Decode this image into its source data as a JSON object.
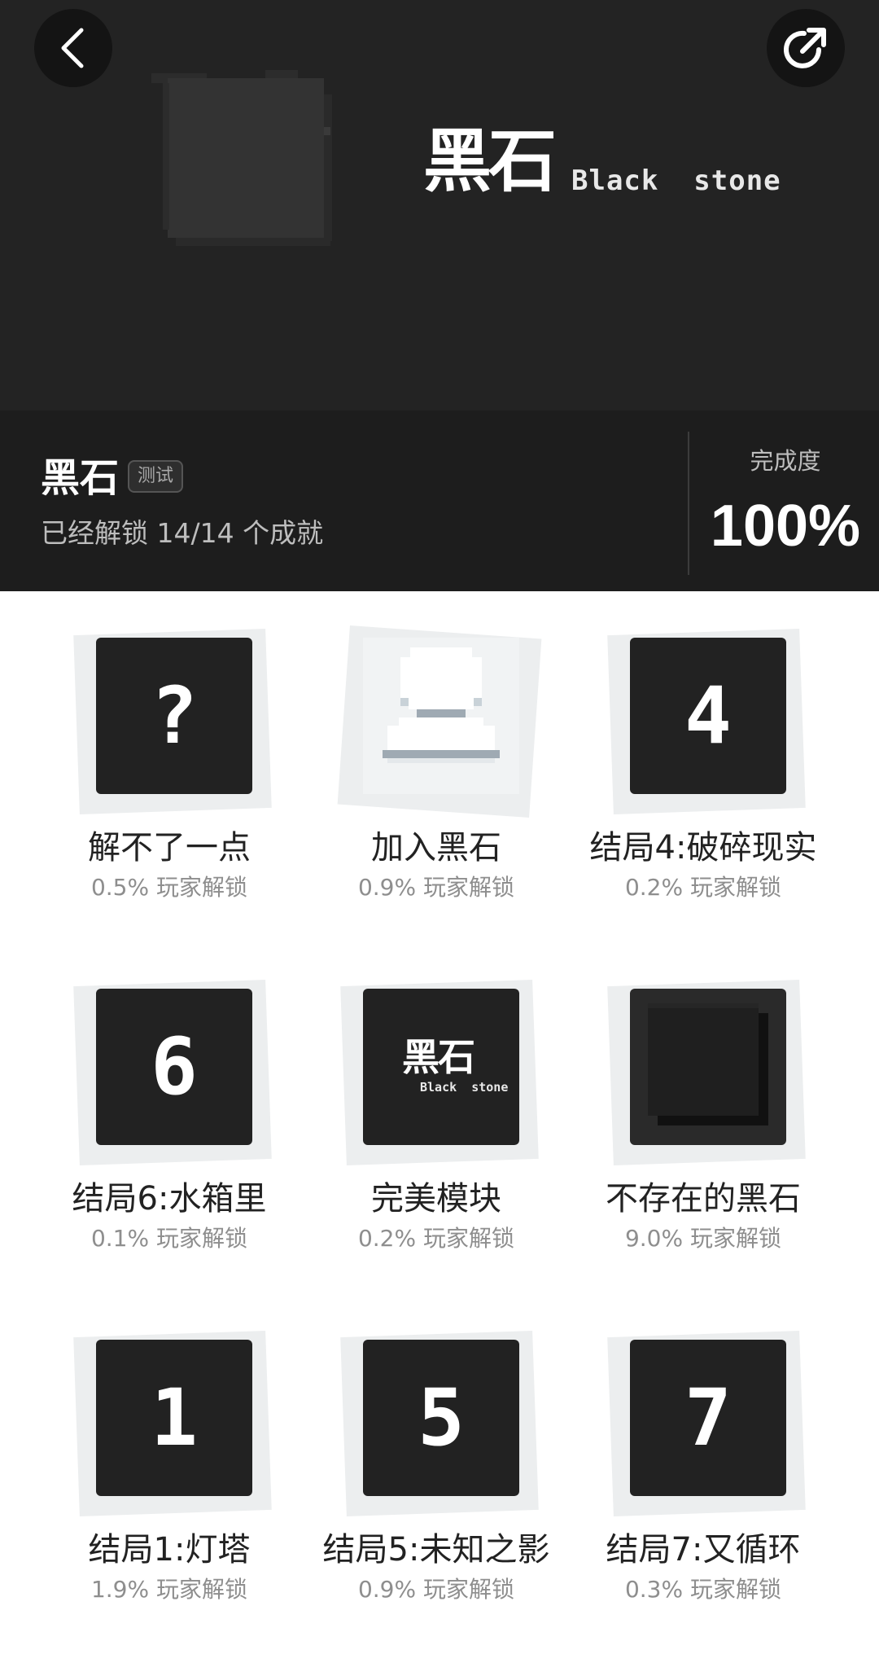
{
  "hero": {
    "logo_cn": "黑石",
    "logo_en": "Black  stone"
  },
  "game": {
    "title": "黑石",
    "tag": "测试",
    "unlock_text": "已经解锁 14/14 个成就",
    "completion_label": "完成度",
    "completion_value": "100%"
  },
  "achievements": [
    {
      "glyph": "?",
      "name": "解不了一点",
      "rate": "0.5% 玩家解锁"
    },
    {
      "glyph": "",
      "icon": "person-icon",
      "name": "加入黑石",
      "rate": "0.9% 玩家解锁"
    },
    {
      "glyph": "4",
      "name": "结局4:破碎现实",
      "rate": "0.2% 玩家解锁"
    },
    {
      "glyph": "6",
      "name": "结局6:水箱里",
      "rate": "0.1% 玩家解锁"
    },
    {
      "glyph": "",
      "icon": "black-stone-logo-icon",
      "logo_cn": "黑石",
      "logo_en": "Black  stone",
      "name": "完美模块",
      "rate": "0.2% 玩家解锁"
    },
    {
      "glyph": "",
      "icon": "black-square-icon",
      "name": "不存在的黑石",
      "rate": "9.0% 玩家解锁"
    },
    {
      "glyph": "1",
      "name": "结局1:灯塔",
      "rate": "1.9% 玩家解锁"
    },
    {
      "glyph": "5",
      "name": "结局5:未知之影",
      "rate": "0.9% 玩家解锁"
    },
    {
      "glyph": "7",
      "name": "结局7:又循环",
      "rate": "0.3% 玩家解锁"
    }
  ],
  "colors": {
    "hero_bg": "#232323",
    "info_bg": "#1d1d1d",
    "tile_bg": "#222222",
    "tile_back": "#eceeef"
  }
}
